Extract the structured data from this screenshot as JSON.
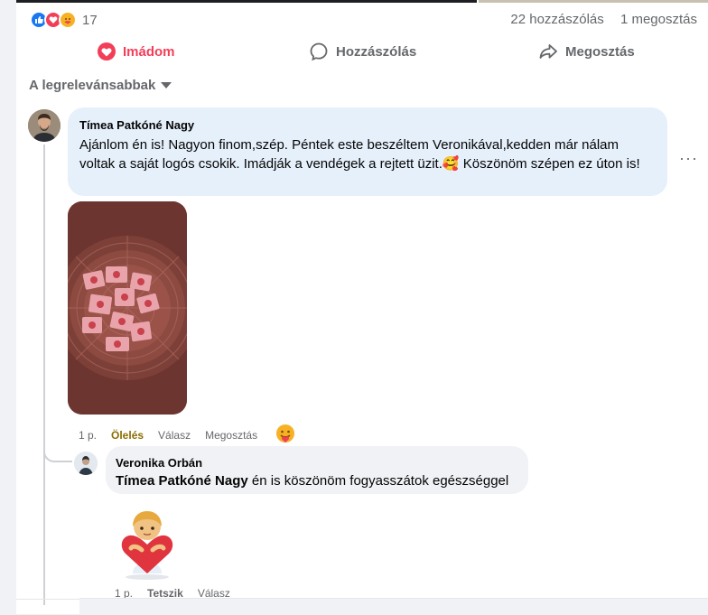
{
  "summary": {
    "reaction_icons": [
      "like-icon",
      "love-icon",
      "care-icon"
    ],
    "reaction_count": "17",
    "comments_count": "22 hozzászólás",
    "shares_count": "1 megosztás"
  },
  "actions": {
    "love_label": "Imádom",
    "comment_label": "Hozzászólás",
    "share_label": "Megosztás"
  },
  "sort": {
    "label": "A legrelevánsabbak"
  },
  "comment1": {
    "author": "Tímea Patkóné Nagy",
    "text": "Ajánlom én is! Nagyon finom,szép. Péntek este beszéltem Veronikával,kedden már nálam voltak a saját logós csokik. Imádják a vendégek a rejtett üzit.🥰 Köszönöm szépen ez úton is!",
    "time": "1 p.",
    "reaction_label": "Ölelés",
    "reply_label": "Válasz",
    "share_label": "Megosztás",
    "reaction_icon": "care-icon"
  },
  "reply1": {
    "author": "Veronika Orbán",
    "tagged": "Tímea Patkóné Nagy",
    "text": " én is köszönöm fogyasszátok egészséggel",
    "time": "1 p.",
    "like_label": "Tetszik",
    "reply_label": "Válasz"
  },
  "colors": {
    "accent_blue": "#1877f2",
    "love_red": "#f33e58",
    "bubble_highlight": "#e6f0fb",
    "bubble_gray": "#f0f2f5",
    "muted_text": "#65676b"
  }
}
